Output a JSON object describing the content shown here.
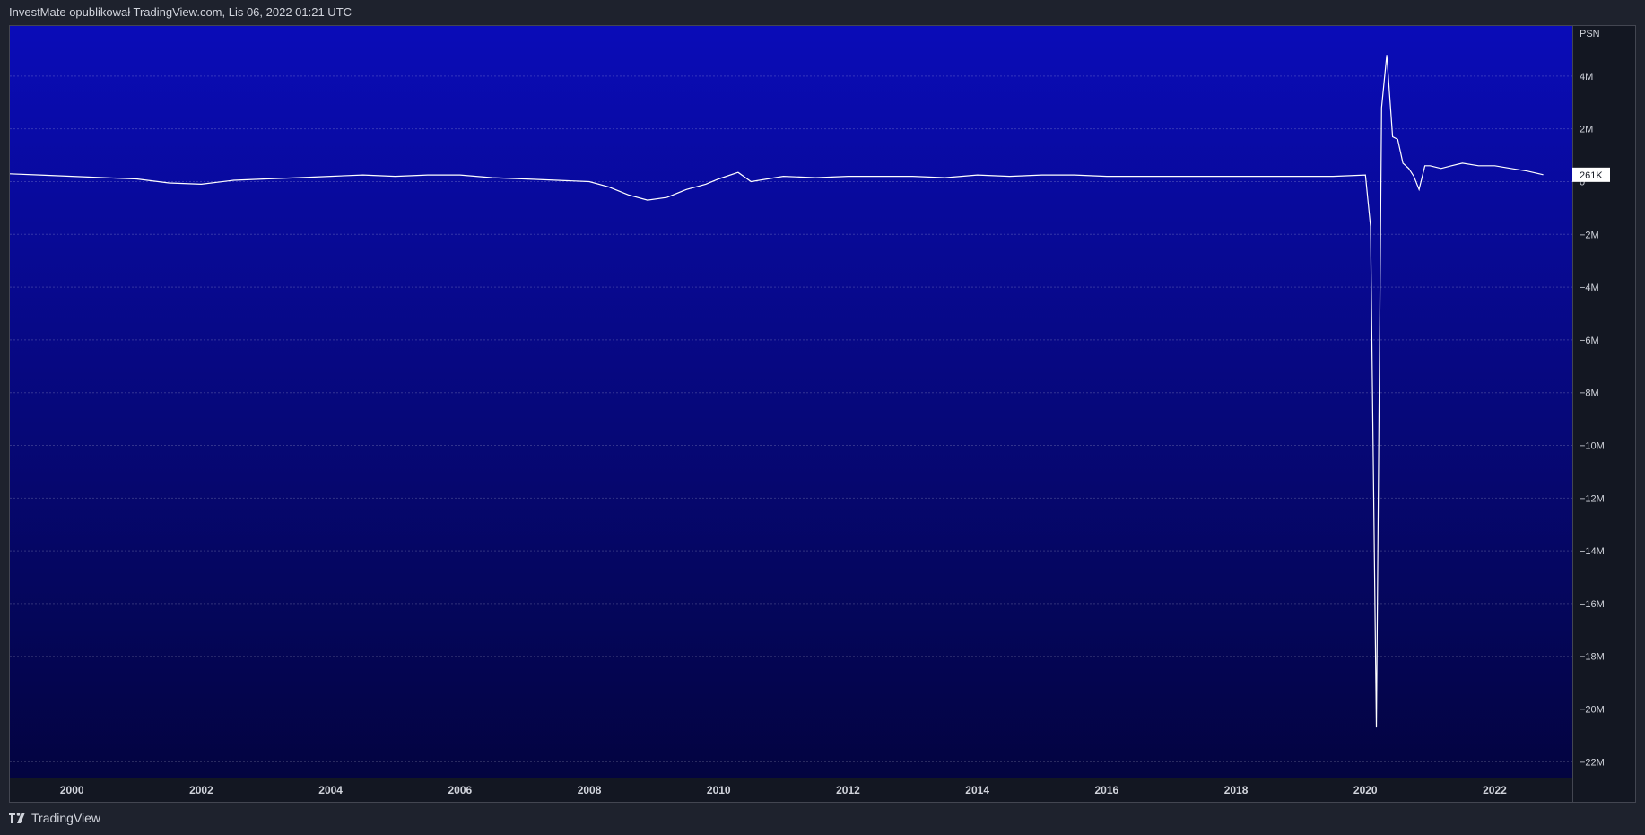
{
  "header": {
    "caption": "InvestMate opublikował TradingView.com, Lis 06, 2022 01:21 UTC"
  },
  "footer": {
    "brand": "TradingView"
  },
  "icons": {
    "brand_logo": "tradingview-logo-icon"
  },
  "colors": {
    "plot_bg_top": "#0a0cb8",
    "plot_bg_bottom": "#030440",
    "line": "#ffffff",
    "frame": "#1e222d"
  },
  "chart_data": {
    "type": "line",
    "symbol": "PSN",
    "last_value_label": "261K",
    "y_ticks": [
      "4M",
      "2M",
      "0",
      "−2M",
      "−4M",
      "−6M",
      "−8M",
      "−10M",
      "−12M",
      "−14M",
      "−16M",
      "−18M",
      "−20M",
      "−22M"
    ],
    "y_tick_values": [
      4,
      2,
      0,
      -2,
      -4,
      -6,
      -8,
      -10,
      -12,
      -14,
      -16,
      -18,
      -20,
      -22
    ],
    "x_ticks": [
      "2000",
      "2002",
      "2004",
      "2006",
      "2008",
      "2010",
      "2012",
      "2014",
      "2016",
      "2018",
      "2020",
      "2022"
    ],
    "x_tick_values": [
      2000,
      2002,
      2004,
      2006,
      2008,
      2010,
      2012,
      2014,
      2016,
      2018,
      2020,
      2022
    ],
    "ylim": [
      -22.6,
      5.9
    ],
    "xlim": [
      1999.04,
      2023.2
    ],
    "grid": true,
    "series": [
      {
        "unit": "millions",
        "x": [
          1999.0,
          1999.5,
          2000.0,
          2000.5,
          2001.0,
          2001.5,
          2002.0,
          2002.5,
          2003.0,
          2003.5,
          2004.0,
          2004.5,
          2005.0,
          2005.5,
          2006.0,
          2006.5,
          2007.0,
          2007.5,
          2008.0,
          2008.3,
          2008.6,
          2008.9,
          2009.2,
          2009.5,
          2009.8,
          2010.0,
          2010.3,
          2010.5,
          2011.0,
          2011.5,
          2012.0,
          2012.5,
          2013.0,
          2013.5,
          2014.0,
          2014.5,
          2015.0,
          2015.5,
          2016.0,
          2016.5,
          2017.0,
          2017.5,
          2018.0,
          2018.5,
          2019.0,
          2019.5,
          2020.0,
          2020.08,
          2020.17,
          2020.25,
          2020.33,
          2020.42,
          2020.5,
          2020.58,
          2020.67,
          2020.75,
          2020.83,
          2020.92,
          2021.0,
          2021.17,
          2021.33,
          2021.5,
          2021.75,
          2022.0,
          2022.25,
          2022.5,
          2022.75
        ],
        "y": [
          0.3,
          0.25,
          0.2,
          0.15,
          0.1,
          -0.05,
          -0.1,
          0.05,
          0.1,
          0.15,
          0.2,
          0.25,
          0.2,
          0.25,
          0.25,
          0.15,
          0.1,
          0.05,
          0.0,
          -0.2,
          -0.5,
          -0.7,
          -0.6,
          -0.3,
          -0.1,
          0.1,
          0.35,
          0.0,
          0.2,
          0.15,
          0.2,
          0.2,
          0.2,
          0.15,
          0.25,
          0.2,
          0.25,
          0.25,
          0.2,
          0.2,
          0.2,
          0.2,
          0.2,
          0.2,
          0.2,
          0.2,
          0.25,
          -1.7,
          -20.7,
          2.8,
          4.8,
          1.7,
          1.6,
          0.7,
          0.5,
          0.2,
          -0.3,
          0.6,
          0.6,
          0.5,
          0.6,
          0.7,
          0.6,
          0.6,
          0.5,
          0.4,
          0.26
        ]
      }
    ]
  }
}
